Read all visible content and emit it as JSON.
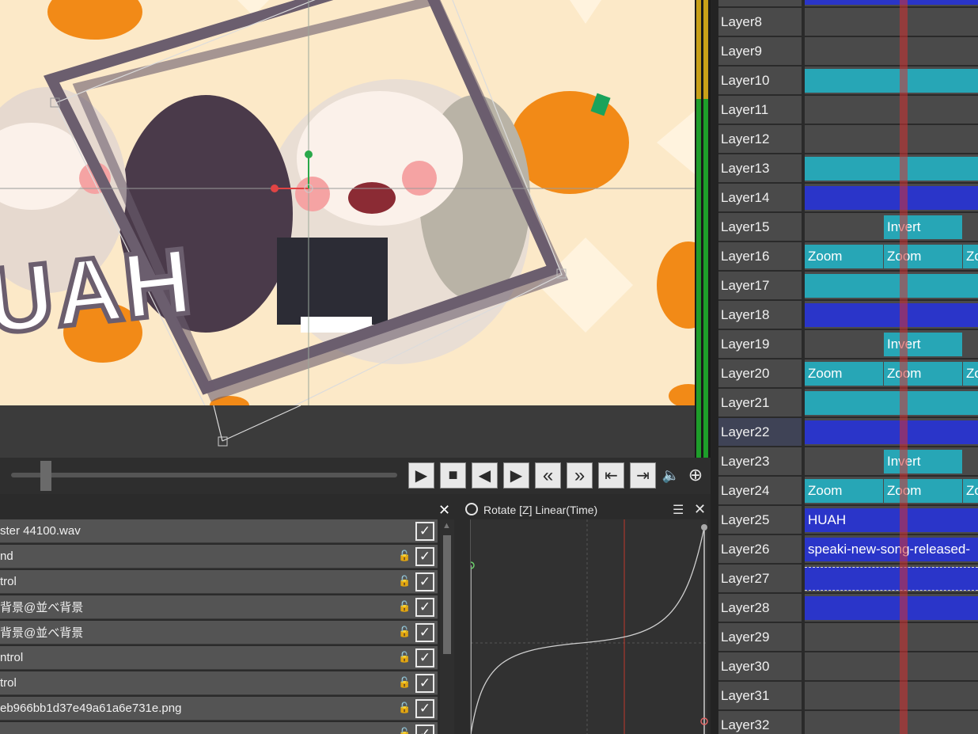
{
  "preview": {
    "overlay_text": "UAH",
    "colors": {
      "background": "#fce9c8",
      "frame": "#6b5e6e",
      "pumpkin": "#f28a17"
    }
  },
  "transport": {
    "buttons": [
      {
        "name": "play-button",
        "glyph": "▶"
      },
      {
        "name": "stop-button",
        "glyph": "■"
      },
      {
        "name": "prev-frame-button",
        "glyph": "◀"
      },
      {
        "name": "next-frame-button",
        "glyph": "▶"
      },
      {
        "name": "rewind-button",
        "glyph": "«"
      },
      {
        "name": "fast-forward-button",
        "glyph": "»"
      },
      {
        "name": "go-start-button",
        "glyph": "⇤"
      },
      {
        "name": "go-end-button",
        "glyph": "⇥"
      }
    ],
    "volume_icon": "🔈",
    "zoom_icon": "⊕"
  },
  "layers_panel": {
    "close_label": "✕",
    "rows": [
      {
        "label": "ster 44100.wav",
        "locked": false,
        "checked": true
      },
      {
        "label": "nd",
        "locked": true,
        "checked": true
      },
      {
        "label": "trol",
        "locked": true,
        "checked": true
      },
      {
        "label": "背景@並べ背景",
        "locked": true,
        "checked": true
      },
      {
        "label": "背景@並べ背景",
        "locked": true,
        "checked": true
      },
      {
        "label": "ntrol",
        "locked": true,
        "checked": true
      },
      {
        "label": "trol",
        "locked": true,
        "checked": true
      },
      {
        "label": "eb966bb1d37e49a61a6e731e.png",
        "locked": true,
        "checked": true
      },
      {
        "label": "",
        "locked": true,
        "checked": true
      }
    ],
    "check_glyph": "✓",
    "lock_glyph": "🔓"
  },
  "curve_panel": {
    "title": "Rotate [Z] Linear(Time)",
    "menu_icon": "☰",
    "close_label": "✕",
    "curve_color": "#d0d0d0",
    "time_marker_color": "#c0392b"
  },
  "timeline": {
    "rows": [
      {
        "label": "Layer8",
        "clips": []
      },
      {
        "label": "Layer9",
        "clips": []
      },
      {
        "label": "Layer10",
        "clips": [
          {
            "kind": "teal",
            "text": "",
            "from": 0,
            "to": 219
          }
        ]
      },
      {
        "label": "Layer11",
        "clips": []
      },
      {
        "label": "Layer12",
        "clips": []
      },
      {
        "label": "Layer13",
        "clips": [
          {
            "kind": "teal",
            "text": "",
            "from": 0,
            "to": 219
          }
        ]
      },
      {
        "label": "Layer14",
        "clips": [
          {
            "kind": "blue",
            "text": "",
            "from": 0,
            "to": 219
          }
        ]
      },
      {
        "label": "Layer15",
        "clips": [
          {
            "kind": "teal",
            "text": "Invert",
            "from": 100,
            "to": 200
          }
        ]
      },
      {
        "label": "Layer16",
        "clips": [
          {
            "kind": "teal",
            "text": "Zoom",
            "from": 0,
            "to": 100
          },
          {
            "kind": "teal",
            "text": "Zoom",
            "from": 100,
            "to": 200
          },
          {
            "kind": "teal",
            "text": "Zo",
            "from": 200,
            "to": 219
          }
        ]
      },
      {
        "label": "Layer17",
        "clips": [
          {
            "kind": "teal",
            "text": "",
            "from": 0,
            "to": 219
          }
        ]
      },
      {
        "label": "Layer18",
        "clips": [
          {
            "kind": "blue",
            "text": "",
            "from": 0,
            "to": 219
          }
        ]
      },
      {
        "label": "Layer19",
        "clips": [
          {
            "kind": "teal",
            "text": "Invert",
            "from": 100,
            "to": 200
          }
        ]
      },
      {
        "label": "Layer20",
        "clips": [
          {
            "kind": "teal",
            "text": "Zoom",
            "from": 0,
            "to": 100
          },
          {
            "kind": "teal",
            "text": "Zoom",
            "from": 100,
            "to": 200
          },
          {
            "kind": "teal",
            "text": "Zo",
            "from": 200,
            "to": 219
          }
        ]
      },
      {
        "label": "Layer21",
        "clips": [
          {
            "kind": "teal",
            "text": "",
            "from": 0,
            "to": 219
          }
        ]
      },
      {
        "label": "Layer22",
        "selected": true,
        "clips": [
          {
            "kind": "blue",
            "text": "",
            "from": 0,
            "to": 219
          }
        ]
      },
      {
        "label": "Layer23",
        "clips": [
          {
            "kind": "teal",
            "text": "Invert",
            "from": 100,
            "to": 200
          }
        ]
      },
      {
        "label": "Layer24",
        "clips": [
          {
            "kind": "teal",
            "text": "Zoom",
            "from": 0,
            "to": 100
          },
          {
            "kind": "teal",
            "text": "Zoom",
            "from": 100,
            "to": 200
          },
          {
            "kind": "teal",
            "text": "Zo",
            "from": 200,
            "to": 219
          }
        ]
      },
      {
        "label": "Layer25",
        "clips": [
          {
            "kind": "blue",
            "text": "HUAH",
            "from": 0,
            "to": 219
          }
        ]
      },
      {
        "label": "Layer26",
        "clips": [
          {
            "kind": "blue",
            "text": "speaki-new-song-released-",
            "from": 0,
            "to": 219
          }
        ]
      },
      {
        "label": "Layer27",
        "clips": [
          {
            "kind": "blue dashed",
            "text": "",
            "from": 0,
            "to": 219
          }
        ]
      },
      {
        "label": "Layer28",
        "clips": [
          {
            "kind": "blue",
            "text": "",
            "from": 0,
            "to": 219
          }
        ]
      },
      {
        "label": "Layer29",
        "clips": []
      },
      {
        "label": "Layer30",
        "clips": []
      },
      {
        "label": "Layer31",
        "clips": []
      },
      {
        "label": "Layer32",
        "clips": []
      }
    ]
  }
}
